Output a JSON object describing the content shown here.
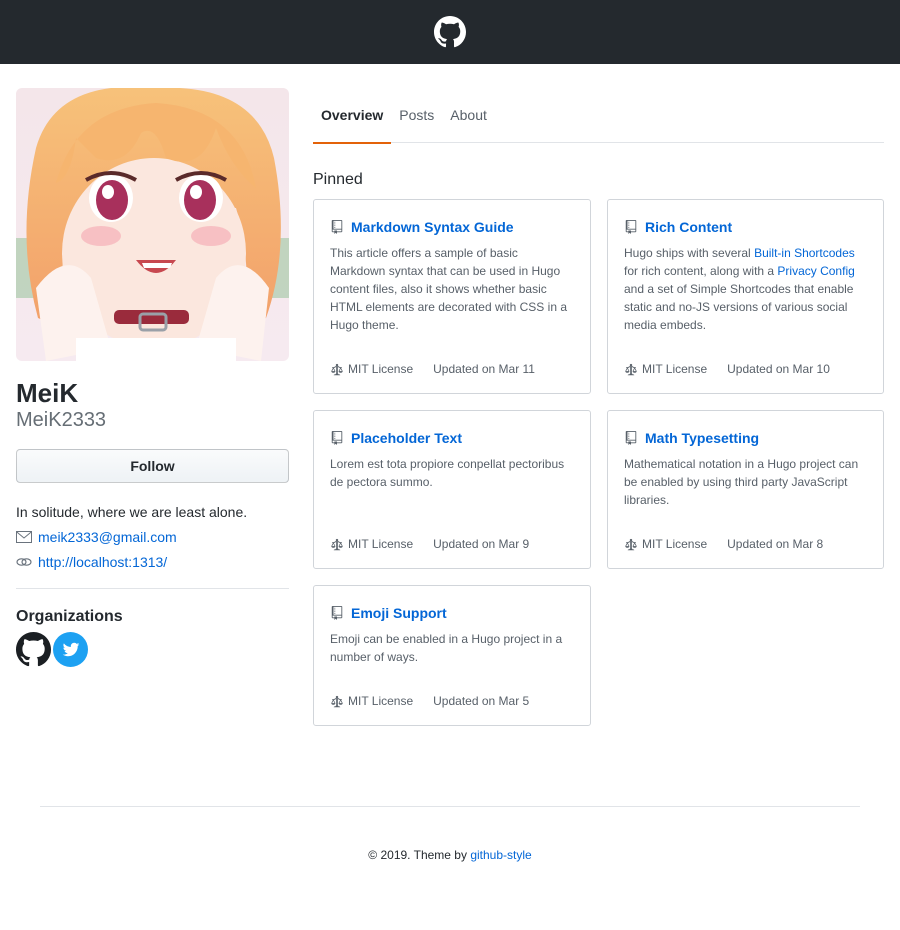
{
  "header": {
    "logo_icon": "github-mark-icon"
  },
  "profile": {
    "avatar_icon": "anime-avatar-image",
    "name": "MeiK",
    "username": "MeiK2333",
    "follow_label": "Follow",
    "bio": "In solitude, where we are least alone.",
    "email": "meik2333@gmail.com",
    "website": "http://localhost:1313/",
    "organizations_title": "Organizations",
    "organizations": [
      {
        "icon": "github-icon"
      },
      {
        "icon": "twitter-icon"
      }
    ]
  },
  "tabs": [
    {
      "label": "Overview",
      "active": true
    },
    {
      "label": "Posts",
      "active": false
    },
    {
      "label": "About",
      "active": false
    }
  ],
  "pinned_title": "Pinned",
  "cards": [
    {
      "title": "Markdown Syntax Guide",
      "description": "This article offers a sample of basic Markdown syntax that can be used in Hugo content files, also it shows whether basic HTML elements are decorated with CSS in a Hugo theme.",
      "license": "MIT License",
      "updated": "Updated on Mar 11"
    },
    {
      "title": "Rich Content",
      "description_parts": {
        "a": "Hugo ships with several ",
        "link1": "Built-in Shortcodes",
        "b": " for rich content, along with a ",
        "link2": "Privacy Config",
        "c": " and a set of Simple Shortcodes that enable static and no-JS versions of various social media embeds."
      },
      "license": "MIT License",
      "updated": "Updated on Mar 10"
    },
    {
      "title": "Placeholder Text",
      "description": "Lorem est tota propiore conpellat pectoribus de pectora summo.",
      "license": "MIT License",
      "updated": "Updated on Mar 9"
    },
    {
      "title": "Math Typesetting",
      "description": "Mathematical notation in a Hugo project can be enabled by using third party JavaScript libraries.",
      "license": "MIT License",
      "updated": "Updated on Mar 8"
    },
    {
      "title": "Emoji Support",
      "description": "Emoji can be enabled in a Hugo project in a number of ways.",
      "license": "MIT License",
      "updated": "Updated on Mar 5"
    }
  ],
  "footer": {
    "text": "© 2019. Theme by ",
    "link": "github-style"
  },
  "colors": {
    "header_bg": "#24292e",
    "link": "#0366d6",
    "tab_active_underline": "#e36209",
    "twitter": "#1da1f2"
  }
}
